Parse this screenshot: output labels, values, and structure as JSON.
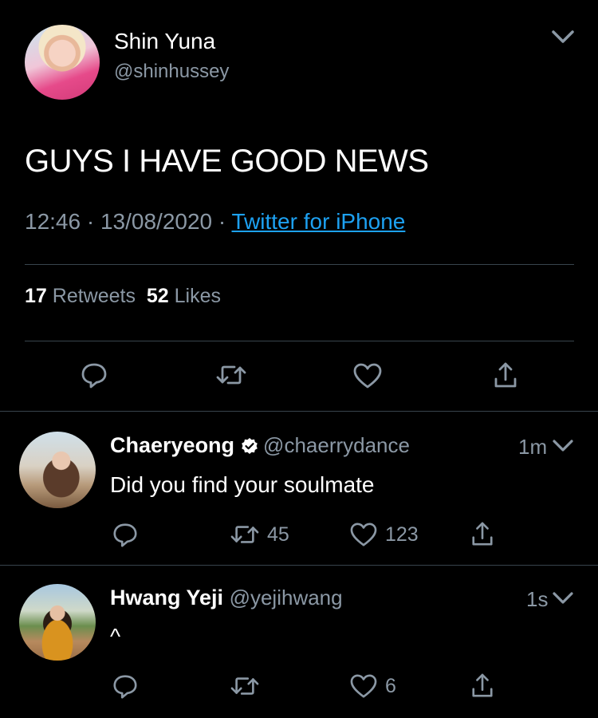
{
  "tweet": {
    "name": "Shin Yuna",
    "handle": "@shinhussey",
    "text": "GUYS I HAVE GOOD NEWS",
    "time": "12:46",
    "date": "13/08/2020",
    "source": "Twitter for iPhone",
    "retweets_count": "17",
    "retweets_label": "Retweets",
    "likes_count": "52",
    "likes_label": "Likes"
  },
  "replies": [
    {
      "name": "Chaeryeong",
      "verified": true,
      "handle": "@chaerrydance",
      "time": "1m",
      "text": "Did you find your soulmate",
      "retweets": "45",
      "likes": "123"
    },
    {
      "name": "Hwang Yeji",
      "verified": false,
      "handle": "@yejihwang",
      "time": "1s",
      "text": "^",
      "retweets": "",
      "likes": "6"
    }
  ],
  "colors": {
    "background": "#000000",
    "secondary_text": "#8b98a5",
    "link": "#1da1f2",
    "divider": "#38444d"
  },
  "icons": [
    "chevron-down-icon",
    "reply-icon",
    "retweet-icon",
    "like-icon",
    "share-icon",
    "verified-icon"
  ]
}
